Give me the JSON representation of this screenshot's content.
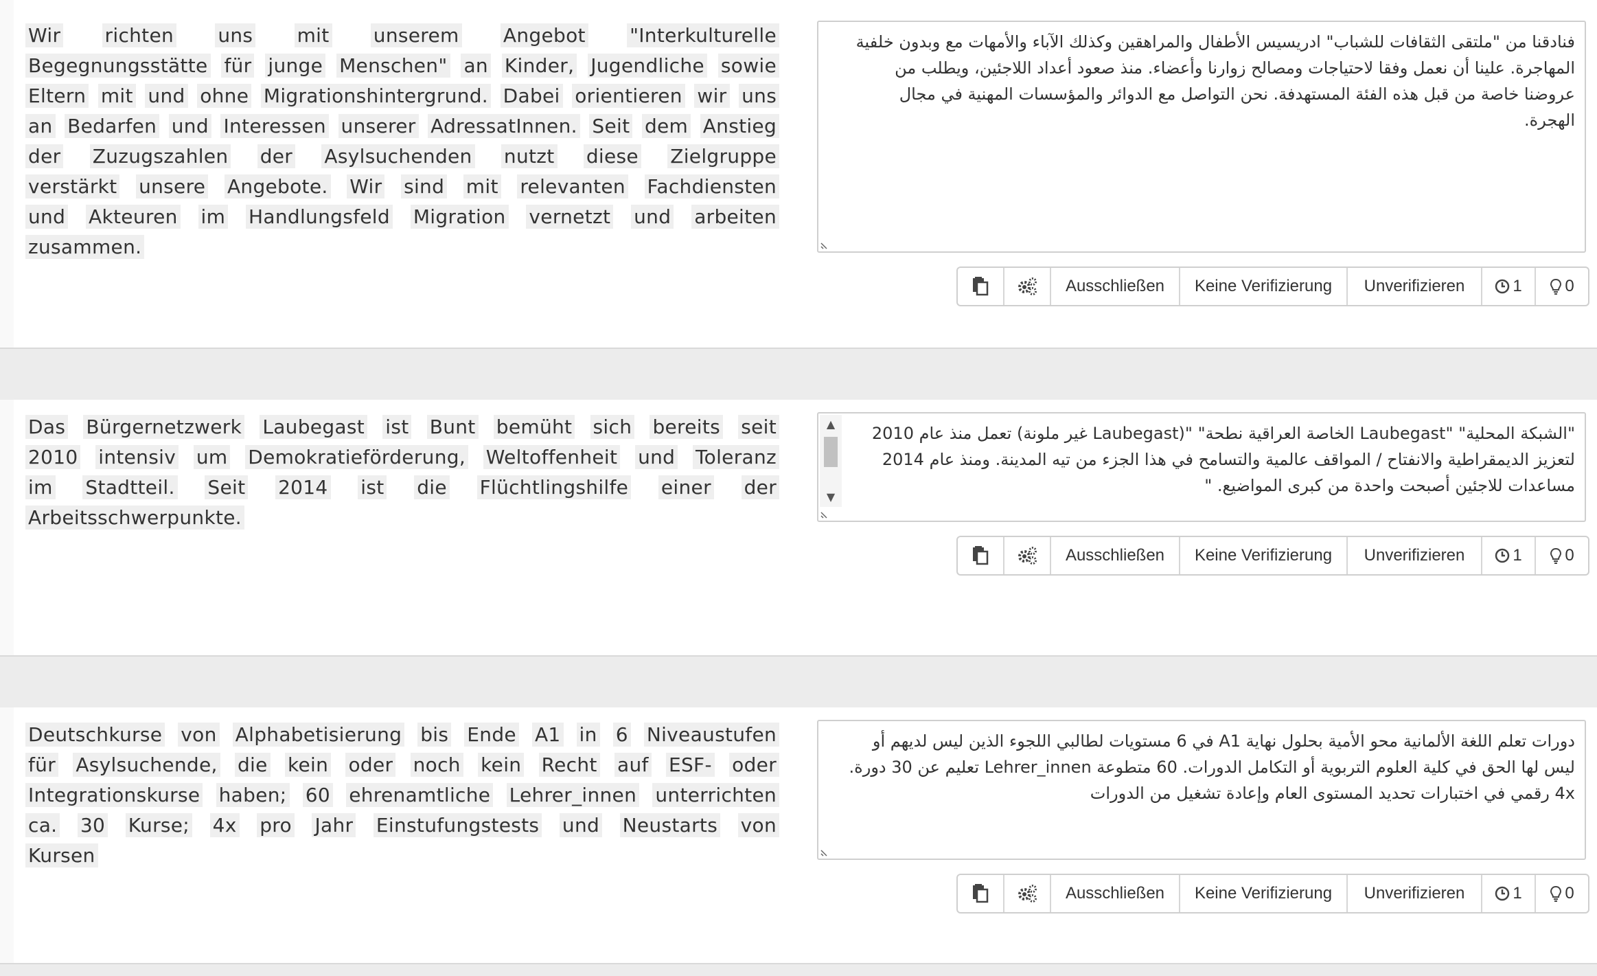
{
  "entries": [
    {
      "source_words": [
        "Wir",
        "richten",
        "uns",
        "mit",
        "unserem",
        "Angebot",
        "\"Interkulturelle",
        "Begegnungsstätte",
        "für",
        "junge",
        "Menschen\"",
        "an",
        "Kinder,",
        "Jugendliche",
        "sowie",
        "Eltern",
        "mit",
        "und",
        "ohne",
        "Migrationshintergrund.",
        "Dabei",
        "orientieren",
        "wir",
        "uns",
        "an",
        "Bedarfen",
        "und",
        "Interessen",
        "unserer",
        "AdressatInnen.",
        "Seit",
        "dem",
        "Anstieg",
        "der",
        "Zuzugszahlen",
        "der",
        "Asylsuchenden",
        "nutzt",
        "diese",
        "Zielgruppe",
        "verstärkt",
        "unsere",
        "Angebote.",
        "Wir",
        "sind",
        "mit",
        "relevanten",
        "Fachdiensten",
        "und",
        "Akteuren",
        "im",
        "Handlungsfeld",
        "Migration",
        "vernetzt",
        "und",
        "arbeiten",
        "zusammen."
      ],
      "translation": "فنادقنا من \"ملتقى الثقافات للشباب\" ادريسيس الأطفال والمراهقين وكذلك الآباء والأمهات مع وبدون خلفية المهاجرة. علينا أن نعمل وفقا لاحتياجات ومصالح زوارنا وأعضاء. منذ صعود أعداد اللاجئين، ويطلب من عروضنا خاصة من قبل هذه الفئة المستهدفة. نحن التواصل مع الدوائر والمؤسسات المهنية في مجال الهجرة.",
      "toolbar": {
        "exclude": "Ausschließen",
        "no_verify": "Keine Verifizierung",
        "unverify": "Unverifizieren",
        "history_count": "1",
        "hint_count": "0"
      }
    },
    {
      "source_words": [
        "Das",
        "Bürgernetzwerk",
        "Laubegast",
        "ist",
        "Bunt",
        "bemüht",
        "sich",
        "bereits",
        "seit",
        "2010",
        "intensiv",
        "um",
        "Demokratieförderung,",
        "Weltoffenheit",
        "und",
        "Toleranz",
        "im",
        "Stadtteil.",
        "Seit",
        "2014",
        "ist",
        "die",
        "Flüchtlingshilfe",
        "einer",
        "der",
        "Arbeitsschwerpunkte."
      ],
      "translation": "\"الشبكة المحلية\" \"Laubegast الخاصة العراقية نطحة\" \"(Laubegast غير ملونة) تعمل منذ عام 2010 لتعزيز الديمقراطية والانفتاح / المواقف عالمية والتسامح في هذا الجزء من تيه المدينة. ومنذ عام 2014 مساعدات للاجئين أصبحت واحدة من كبرى المواضيع. \"",
      "toolbar": {
        "exclude": "Ausschließen",
        "no_verify": "Keine Verifizierung",
        "unverify": "Unverifizieren",
        "history_count": "1",
        "hint_count": "0"
      }
    },
    {
      "source_words": [
        "Deutschkurse",
        "von",
        "Alphabetisierung",
        "bis",
        "Ende",
        "A1",
        "in",
        "6",
        "Niveaustufen",
        "für",
        "Asylsuchende,",
        "die",
        "kein",
        "oder",
        "noch",
        "kein",
        "Recht",
        "auf",
        "ESF-",
        "oder",
        "Integrationskurse",
        "haben;",
        "60",
        "ehrenamtliche",
        "Lehrer_innen",
        "unterrichten",
        "ca.",
        "30",
        "Kurse;",
        "4x",
        "pro",
        "Jahr",
        "Einstufungstests",
        "und",
        "Neustarts",
        "von",
        "Kursen"
      ],
      "translation": "دورات تعلم اللغة الألمانية محو الأمية بحلول نهاية A1 في 6 مستويات لطالبي اللجوء الذين ليس لديهم أو ليس لها الحق في كلية العلوم التربوية أو التكامل الدورات. 60 متطوعة Lehrer_innen تعليم عن 30 دورة. 4x رقمي في اختبارات تحديد المستوى العام وإعادة تشغيل من الدورات",
      "toolbar": {
        "exclude": "Ausschließen",
        "no_verify": "Keine Verifizierung",
        "unverify": "Unverifizieren",
        "history_count": "1",
        "hint_count": "0"
      }
    }
  ],
  "icons": {
    "copy": "copy-source-icon",
    "settings": "machine-translate-icon",
    "history": "clock-icon",
    "hint": "lightbulb-icon"
  }
}
